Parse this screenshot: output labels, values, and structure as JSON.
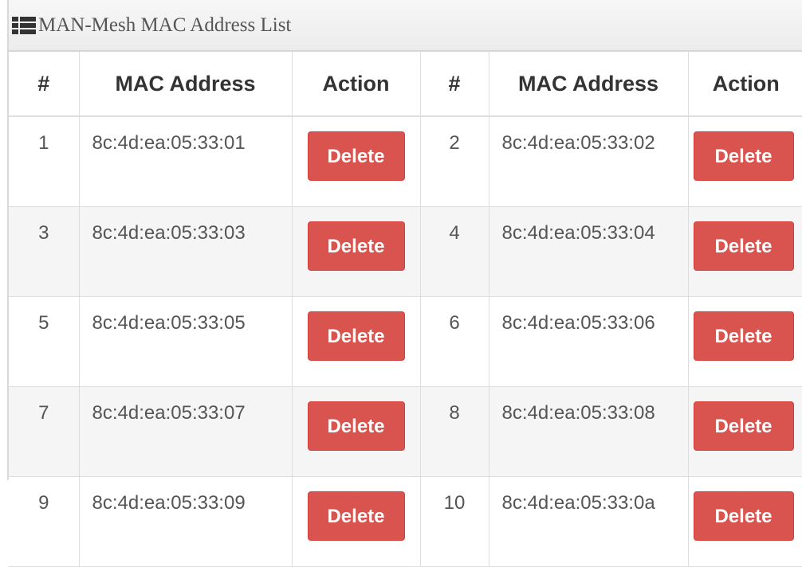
{
  "panel": {
    "title": "MAN-Mesh MAC Address List",
    "icon": "list-icon"
  },
  "table": {
    "headers": [
      "#",
      "MAC Address",
      "Action",
      "#",
      "MAC Address",
      "Action"
    ],
    "delete_label": "Delete",
    "rows": [
      {
        "num_a": "1",
        "mac_a": "8c:4d:ea:05:33:01",
        "num_b": "2",
        "mac_b": "8c:4d:ea:05:33:02"
      },
      {
        "num_a": "3",
        "mac_a": "8c:4d:ea:05:33:03",
        "num_b": "4",
        "mac_b": "8c:4d:ea:05:33:04"
      },
      {
        "num_a": "5",
        "mac_a": "8c:4d:ea:05:33:05",
        "num_b": "6",
        "mac_b": "8c:4d:ea:05:33:06"
      },
      {
        "num_a": "7",
        "mac_a": "8c:4d:ea:05:33:07",
        "num_b": "8",
        "mac_b": "8c:4d:ea:05:33:08"
      },
      {
        "num_a": "9",
        "mac_a": "8c:4d:ea:05:33:09",
        "num_b": "10",
        "mac_b": "8c:4d:ea:05:33:0a"
      }
    ]
  },
  "colors": {
    "delete_button": "#d9534f",
    "row_stripe": "#f5f5f5",
    "heading_bg": "#ececec"
  }
}
